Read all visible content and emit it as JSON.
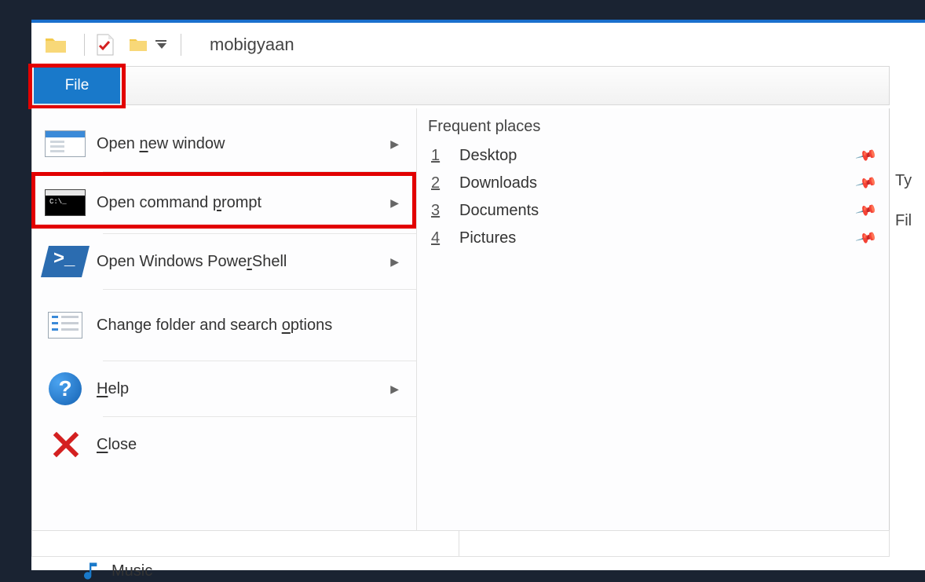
{
  "window": {
    "title": "mobigyaan"
  },
  "ribbon": {
    "file_tab": "File"
  },
  "menu": {
    "open_new_window": "Open new window",
    "open_cmd": "Open command prompt",
    "open_ps": "Open Windows PowerShell",
    "change_opts": "Change folder and search options",
    "help": "Help",
    "close": "Close"
  },
  "accelerators": {
    "new_window": "n",
    "cmd": "p",
    "ps": "r",
    "opts": "o",
    "help": "H",
    "close": "C"
  },
  "frequent": {
    "header": "Frequent places",
    "items": [
      {
        "num": "1",
        "label": "Desktop"
      },
      {
        "num": "2",
        "label": "Downloads"
      },
      {
        "num": "3",
        "label": "Documents"
      },
      {
        "num": "4",
        "label": "Pictures"
      }
    ]
  },
  "right_columns": {
    "col1": "Ty",
    "col2": "Fil"
  },
  "sidebar_peek": {
    "label": "Music"
  }
}
